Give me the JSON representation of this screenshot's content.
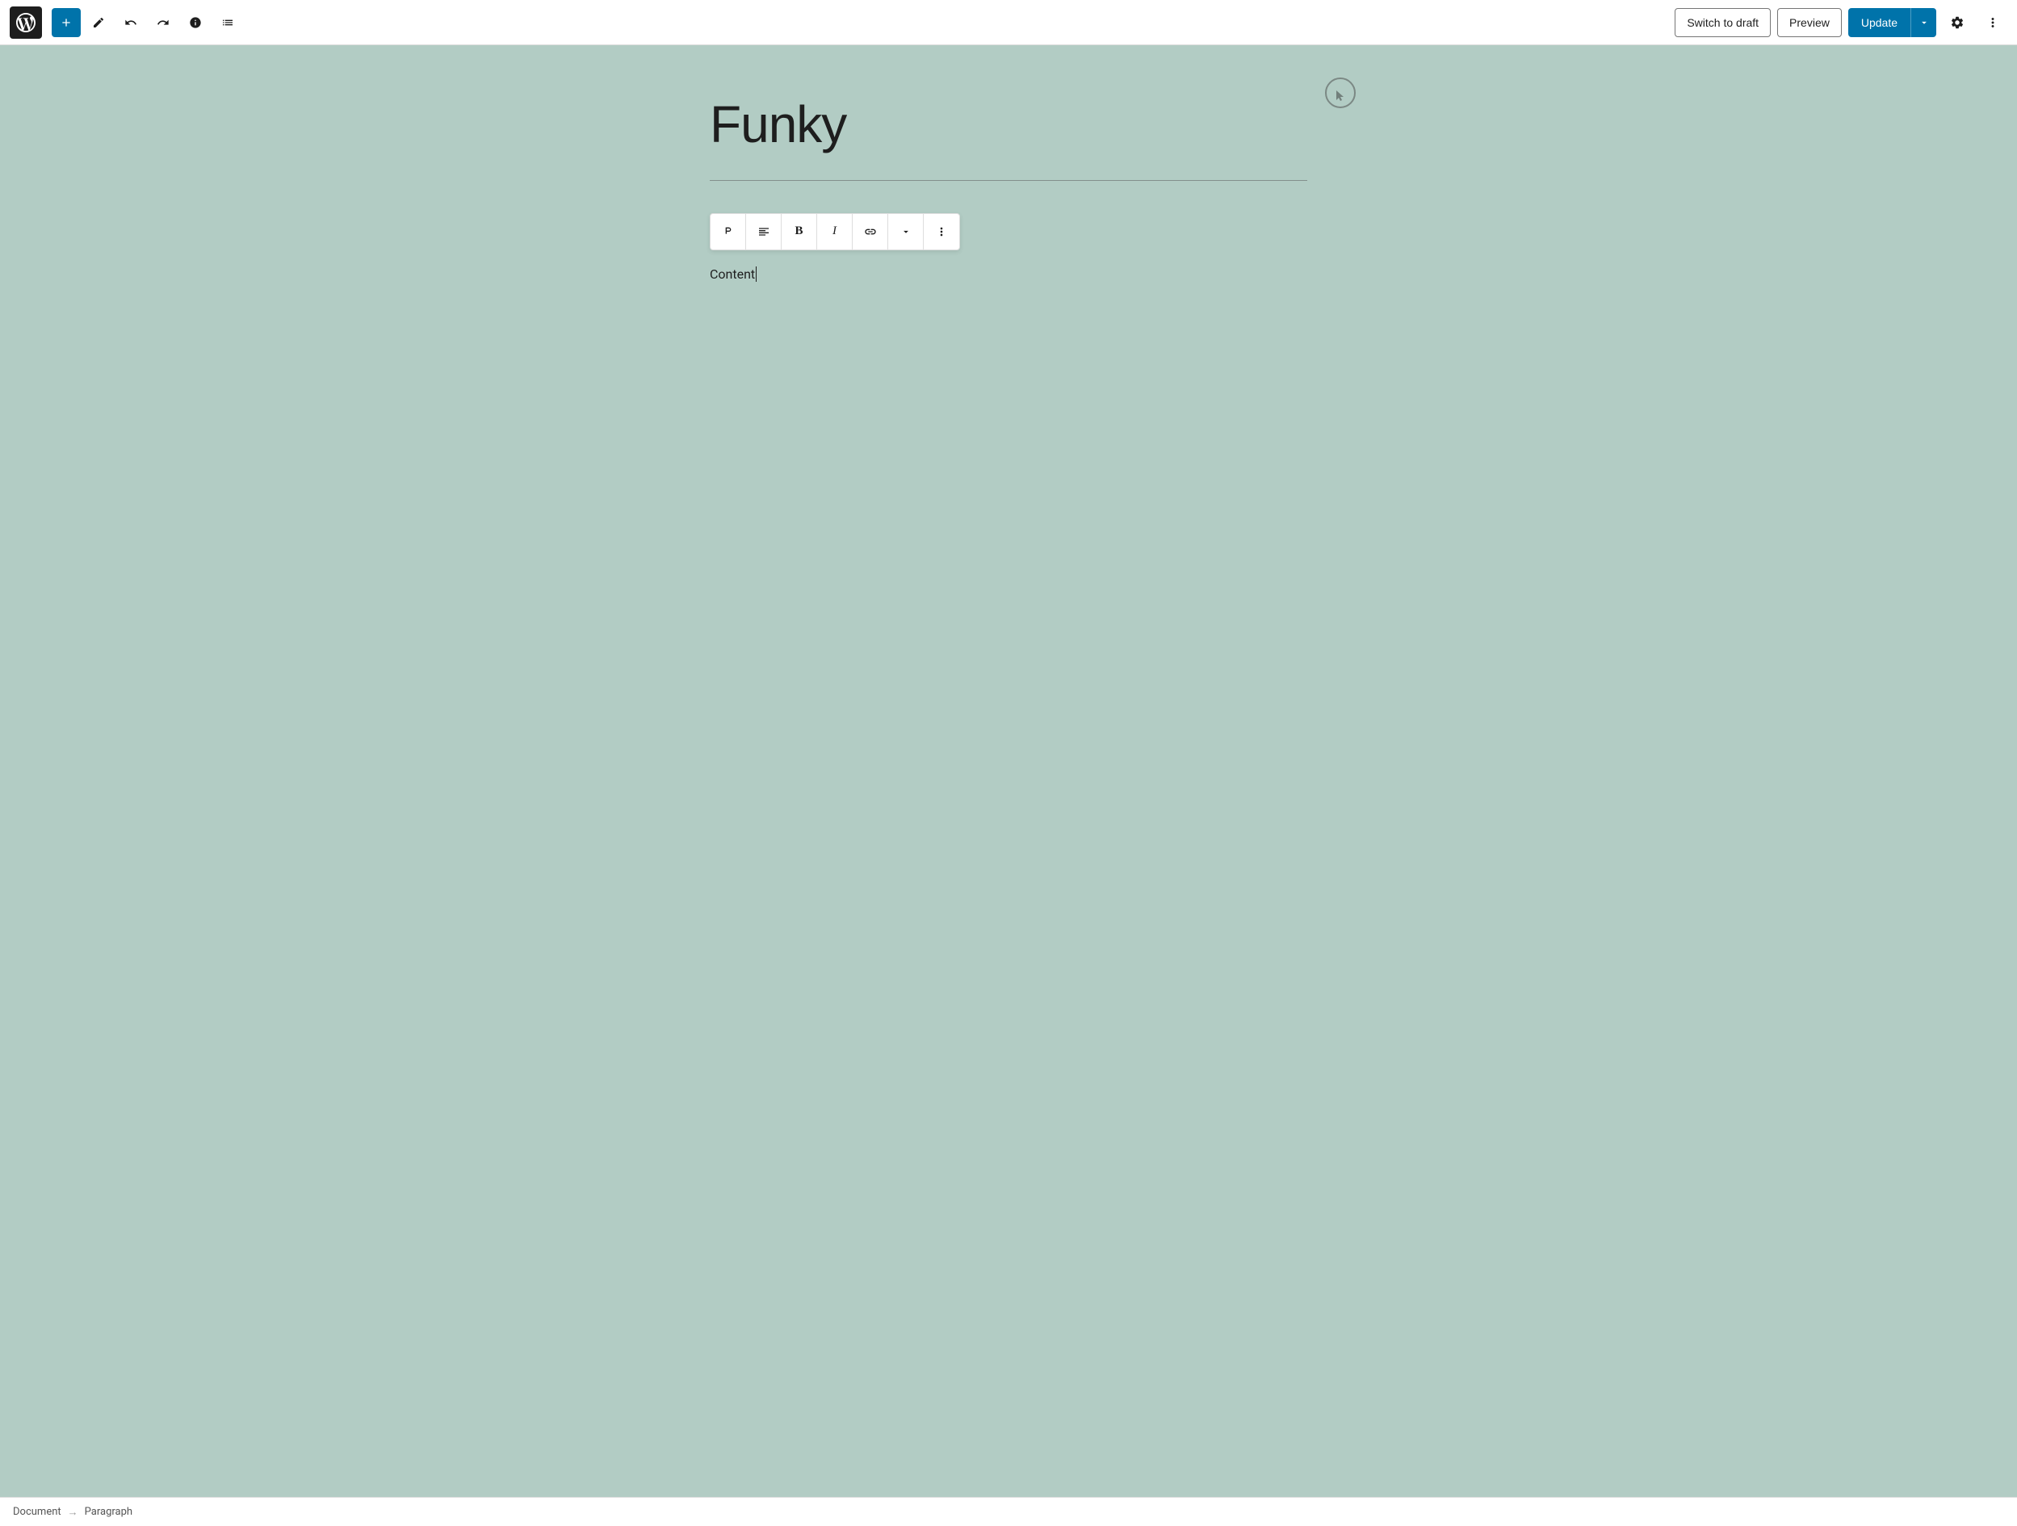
{
  "toolbar": {
    "add_label": "+",
    "switch_draft_label": "Switch to draft",
    "preview_label": "Preview",
    "update_label": "Update"
  },
  "editor": {
    "post_title": "Funky",
    "paragraph_content": "Content"
  },
  "statusbar": {
    "breadcrumb_document": "Document",
    "breadcrumb_paragraph": "Paragraph"
  },
  "icons": {
    "wp_logo": "wordpress",
    "add": "plus",
    "pen": "pencil",
    "undo": "undo",
    "redo": "redo",
    "info": "info",
    "list": "list",
    "paragraph": "paragraph",
    "align": "align-center",
    "bold": "bold",
    "italic": "italic",
    "link": "link",
    "chevron_down": "chevron-down",
    "more": "more-vertical",
    "settings_gear": "gear",
    "ellipsis": "ellipsis",
    "arrow_down": "arrow-down"
  },
  "colors": {
    "accent": "#0073aa",
    "background": "#b2ccc4",
    "toolbar_bg": "#ffffff",
    "text_primary": "#1e1e1e"
  }
}
